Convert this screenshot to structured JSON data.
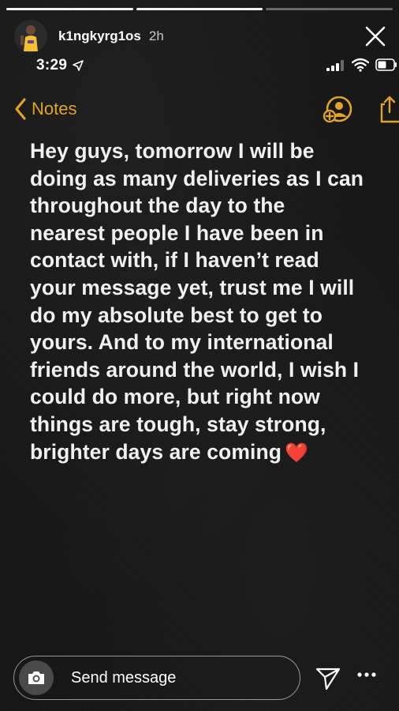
{
  "story": {
    "username": "k1ngkyrg1os",
    "time_ago": "2h",
    "progress_segments": [
      {
        "state": "done"
      },
      {
        "state": "done"
      },
      {
        "state": "current"
      }
    ]
  },
  "phone_status": {
    "clock": "3:29",
    "icons": [
      "location-arrow-icon",
      "signal-icon",
      "wifi-icon",
      "battery-icon"
    ]
  },
  "notes_app": {
    "back_label": "Notes",
    "accent_color": "#e0a526",
    "note_text": "Hey guys, tomorrow I will be\ndoing as many deliveries as I can\nthroughout the day to the\nnearest people I have been in\ncontact with, if I haven’t read\nyour message yet, trust me I will\ndo my absolute best to get to\nyours. And to my international\nfriends around the world, I wish I\ncould do more, but right now\nthings are tough, stay strong,\nbrighter days are coming",
    "note_emoji": "❤️"
  },
  "composer": {
    "placeholder": "Send message"
  }
}
